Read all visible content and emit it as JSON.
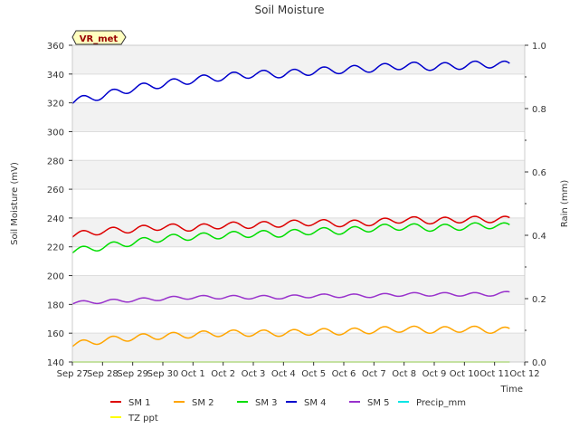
{
  "chart_data": {
    "type": "line",
    "title": "Soil Moisture",
    "xlabel": "Time",
    "ylabel": "Soil Moisture (mV)",
    "y2label": "Rain (mm)",
    "badge": "VR_met",
    "xlim": [
      "2023-09-27",
      "2023-10-12"
    ],
    "ylim": [
      140,
      360
    ],
    "y2lim": [
      0.0,
      1.0
    ],
    "x_ticks": [
      "Sep 27",
      "Sep 28",
      "Sep 29",
      "Sep 30",
      "Oct 1",
      "Oct 2",
      "Oct 3",
      "Oct 4",
      "Oct 5",
      "Oct 6",
      "Oct 7",
      "Oct 8",
      "Oct 9",
      "Oct 10",
      "Oct 11",
      "Oct 12"
    ],
    "y_ticks": [
      "140",
      "160",
      "180",
      "200",
      "220",
      "240",
      "260",
      "280",
      "300",
      "320",
      "340",
      "360"
    ],
    "y2_ticks": [
      "0.0",
      "0.2",
      "0.4",
      "0.6",
      "0.8",
      "1.0"
    ],
    "grid": "horizontal bands",
    "legend_position": "bottom",
    "x": [
      "2023-09-27",
      "2023-09-28",
      "2023-09-29",
      "2023-09-30",
      "2023-10-01",
      "2023-10-02",
      "2023-10-03",
      "2023-10-04",
      "2023-10-05",
      "2023-10-06",
      "2023-10-07",
      "2023-10-08",
      "2023-10-09",
      "2023-10-10",
      "2023-10-11",
      "2023-10-11 12:00"
    ],
    "series": [
      {
        "name": "SM 1",
        "color": "#dd0000",
        "axis": "left",
        "values": [
          228,
          231,
          232,
          234,
          233,
          235,
          235,
          236,
          237,
          236,
          237,
          239,
          238,
          239,
          239,
          239
        ]
      },
      {
        "name": "SM 2",
        "color": "#ffa500",
        "axis": "left",
        "values": [
          152,
          155,
          157,
          158,
          159,
          160,
          160,
          160,
          161,
          161,
          162,
          163,
          162,
          163,
          162,
          162
        ]
      },
      {
        "name": "SM 3",
        "color": "#00dd00",
        "axis": "left",
        "values": [
          217,
          220,
          223,
          226,
          227,
          228,
          229,
          229,
          231,
          231,
          233,
          234,
          233,
          234,
          235,
          234
        ]
      },
      {
        "name": "SM 4",
        "color": "#0000cc",
        "axis": "left",
        "values": [
          321,
          325,
          330,
          333,
          336,
          338,
          340,
          340,
          342,
          343,
          344,
          346,
          345,
          346,
          347,
          346
        ]
      },
      {
        "name": "SM 5",
        "color": "#9932cc",
        "axis": "left",
        "values": [
          181,
          182,
          183,
          184,
          185,
          185,
          185,
          185,
          186,
          186,
          186,
          187,
          187,
          187,
          187,
          188
        ]
      },
      {
        "name": "Precip_mm",
        "color": "#00e5e5",
        "axis": "right",
        "values": [
          0,
          0,
          0,
          0,
          0,
          0,
          0,
          0,
          0,
          0,
          0,
          0,
          0,
          0,
          0,
          0
        ]
      },
      {
        "name": "TZ ppt",
        "color": "#ffff00",
        "axis": "right",
        "values": [
          0,
          0,
          0,
          0,
          0,
          0,
          0,
          0,
          0,
          0,
          0,
          0,
          0,
          0,
          0,
          0
        ]
      }
    ]
  }
}
